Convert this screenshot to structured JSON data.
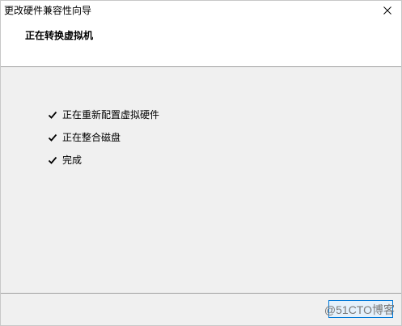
{
  "window": {
    "title": "更改硬件兼容性向导"
  },
  "header": {
    "title": "正在转换虚拟机"
  },
  "steps": [
    {
      "label": "正在重新配置虚拟硬件",
      "status": "done"
    },
    {
      "label": "正在整合磁盘",
      "status": "done"
    },
    {
      "label": "完成",
      "status": "done"
    }
  ],
  "footer": {
    "watermark": "@51CTO博客"
  },
  "colors": {
    "content_bg": "#f0f0f0",
    "button_border": "#0078d7",
    "divider": "#a0a0a0"
  },
  "icons": {
    "close": "close-icon",
    "check": "check-icon"
  }
}
